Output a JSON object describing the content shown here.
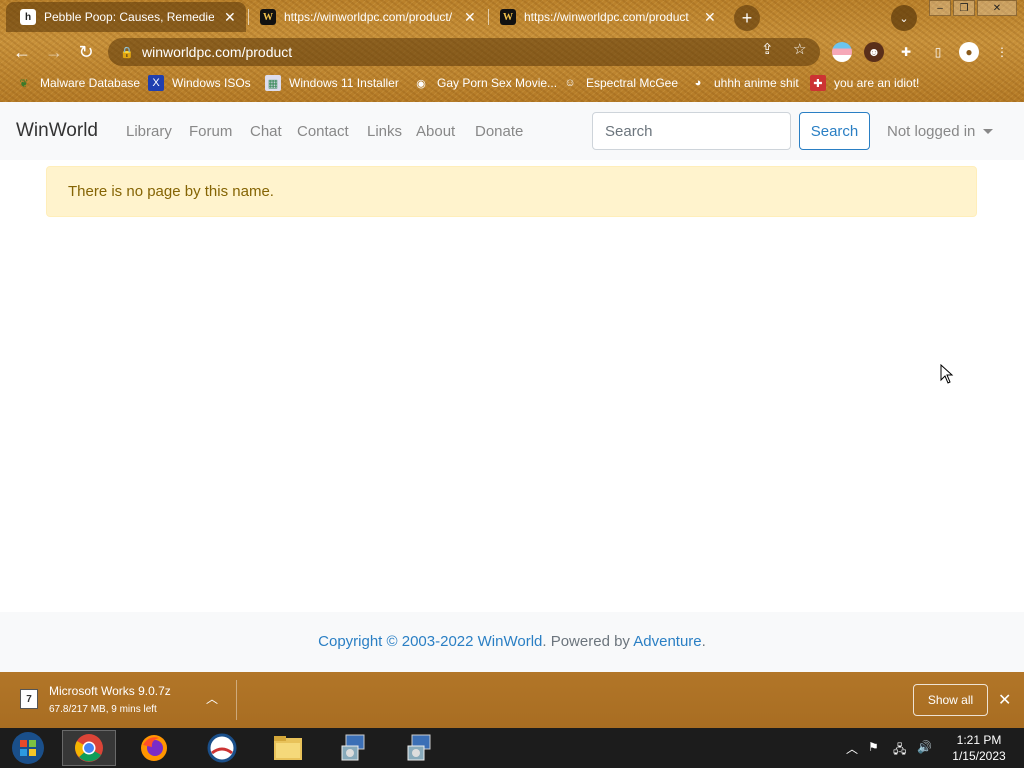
{
  "browser": {
    "tabs": [
      {
        "title": "Pebble Poop: Causes, Remedies, and",
        "favicon": "h",
        "active": true
      },
      {
        "title": "https://winworldpc.com/product/",
        "favicon": "W",
        "active": false
      },
      {
        "title": "https://winworldpc.com/product",
        "favicon": "W",
        "active": false
      }
    ],
    "url": "winworldpc.com/product",
    "bookmarks": [
      {
        "label": "Malware Database",
        "icon": "leaf-icon"
      },
      {
        "label": "Windows ISOs",
        "icon": "x-logo-icon"
      },
      {
        "label": "Windows 11 Installer",
        "icon": "image-icon"
      },
      {
        "label": "Gay Porn Sex Movie...",
        "icon": "globe-icon"
      },
      {
        "label": "Espectral McGee",
        "icon": "face-icon"
      },
      {
        "label": "uhhh anime shit",
        "icon": "anime-icon"
      },
      {
        "label": "you are an idiot!",
        "icon": "flag-icon"
      }
    ]
  },
  "site": {
    "brand": "WinWorld",
    "nav": [
      "Library",
      "Forum",
      "Chat",
      "Contact",
      "Links",
      "About",
      "Donate"
    ],
    "search_placeholder": "Search",
    "search_button": "Search",
    "login": "Not logged in",
    "alert": "There is no page by this name.",
    "footer": {
      "copyright": "Copyright © 2003-2022 WinWorld",
      "powered_by": ". Powered by ",
      "engine": "Adventure",
      "end": "."
    }
  },
  "download": {
    "file": "Microsoft Works 9.0.7z",
    "status": "67.8/217 MB, 9 mins left",
    "show_all": "Show all"
  },
  "taskbar": {
    "time": "1:21 PM",
    "date": "1/15/2023"
  },
  "colors": {
    "accent": "#2a7fc4",
    "alert_bg": "#fff3cd",
    "alert_text": "#856404",
    "theme": "#b9802a"
  }
}
